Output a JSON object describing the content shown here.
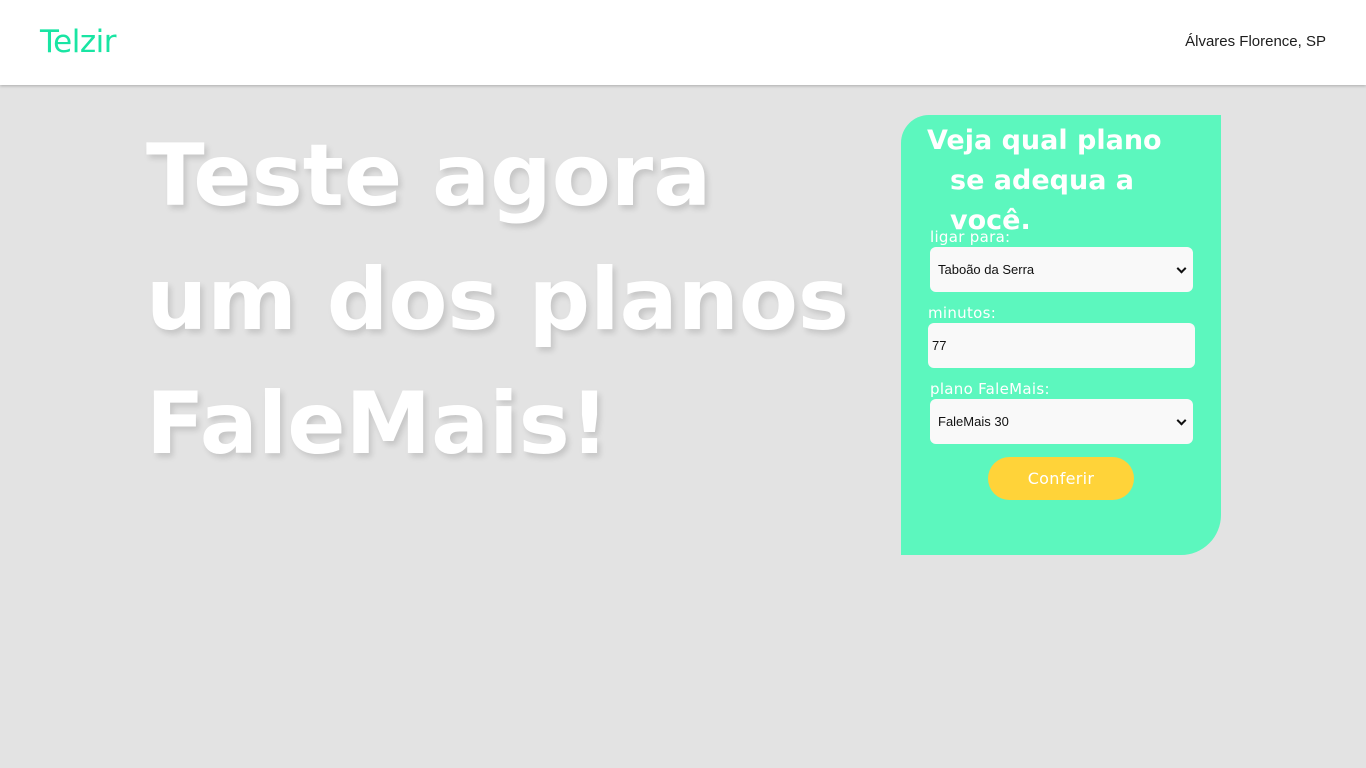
{
  "header": {
    "brand": "Telzir",
    "location": "Álvares Florence, SP"
  },
  "hero": {
    "lines": [
      "Teste agora",
      "um dos planos",
      "FaleMais!"
    ]
  },
  "form": {
    "title_line1": "Veja qual plano",
    "title_line2": "se adequa a você.",
    "destination_label": "ligar para:",
    "destination_value": "Taboão da Serra",
    "minutes_label": "minutos:",
    "minutes_value": "77",
    "plan_label": "plano FaleMais:",
    "plan_value": "FaleMais 30",
    "submit_label": "Conferir"
  },
  "colors": {
    "brand": "#19e5a3",
    "card": "#5cf7be",
    "button": "#ffd339",
    "background": "#e3e3e3"
  }
}
